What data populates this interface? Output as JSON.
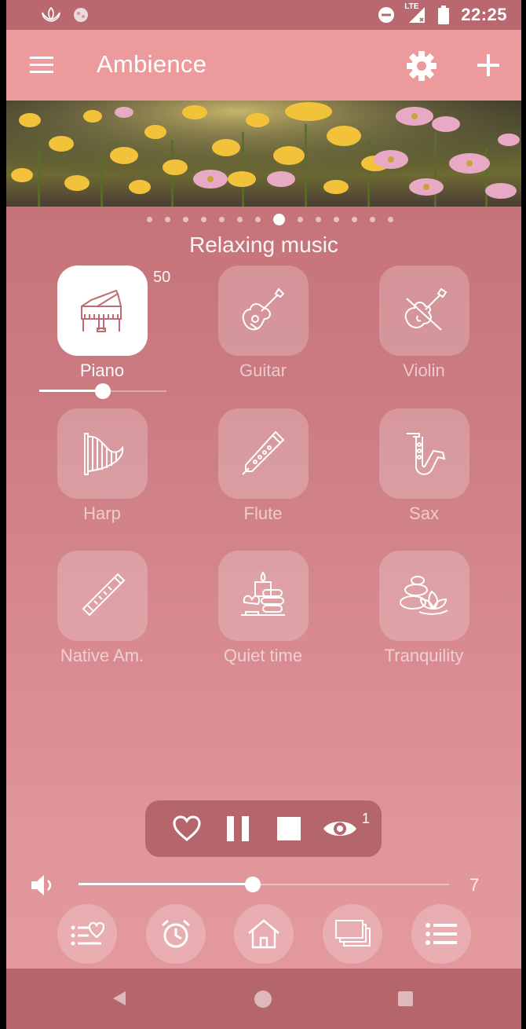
{
  "status": {
    "time": "22:25",
    "network": "LTE",
    "icons": [
      "lotus-icon",
      "circle-icon",
      "do-not-disturb-icon",
      "signal-icon",
      "battery-icon"
    ]
  },
  "appbar": {
    "title": "Ambience",
    "icons": {
      "menu": "hamburger-icon",
      "settings": "gear-icon",
      "add": "plus-icon"
    }
  },
  "pager": {
    "total_pages": 14,
    "active_page": 8
  },
  "section": {
    "title": "Relaxing music"
  },
  "sounds": [
    {
      "label": "Piano",
      "icon": "grand-piano-icon",
      "active": true,
      "volume": "50"
    },
    {
      "label": "Guitar",
      "icon": "guitar-icon",
      "active": false
    },
    {
      "label": "Violin",
      "icon": "violin-icon",
      "active": false
    },
    {
      "label": "Harp",
      "icon": "harp-icon",
      "active": false
    },
    {
      "label": "Flute",
      "icon": "flute-icon",
      "active": false
    },
    {
      "label": "Sax",
      "icon": "saxophone-icon",
      "active": false
    },
    {
      "label": "Native Am.",
      "icon": "native-flute-icon",
      "active": false
    },
    {
      "label": "Quiet time",
      "icon": "candle-stones-icon",
      "active": false
    },
    {
      "label": "Tranquility",
      "icon": "lotus-stones-icon",
      "active": false
    }
  ],
  "piano_slider": {
    "value_fraction": 0.5
  },
  "player": {
    "buttons": [
      "heart-icon",
      "pause-icon",
      "stop-icon",
      "eye-icon"
    ],
    "visible_count": "1"
  },
  "master_volume": {
    "value": "7",
    "fraction": 0.47
  },
  "bottom_tabs": [
    "favorites-list-icon",
    "alarm-clock-icon",
    "home-icon",
    "presets-icon",
    "list-icon"
  ],
  "colors": {
    "appbar": "#ec9a9c",
    "statusbar": "#b9686f",
    "background_top": "#c06b72",
    "background_bottom": "#e59a9e",
    "accent": "#ffffff"
  }
}
